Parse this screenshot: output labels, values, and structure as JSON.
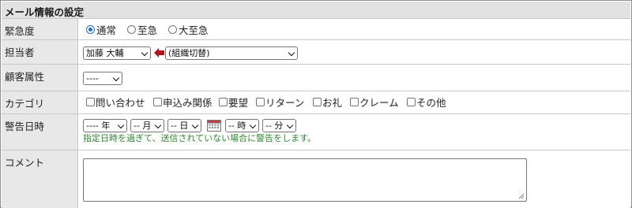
{
  "section_title": "メール情報の設定",
  "urgency": {
    "label": "緊急度",
    "options": [
      "通常",
      "至急",
      "大至急"
    ],
    "selected_index": 0
  },
  "assignee": {
    "label": "担当者",
    "selected": "加藤 大輔",
    "group_selected": "(組織切替)"
  },
  "customer_attribute": {
    "label": "顧客属性",
    "selected": "----"
  },
  "category": {
    "label": "カテゴリ",
    "options": [
      "問い合わせ",
      "申込み関係",
      "要望",
      "リターン",
      "お礼",
      "クレーム",
      "その他"
    ]
  },
  "alert_datetime": {
    "label": "警告日時",
    "year": "---- 年",
    "month": "-- 月",
    "day": "-- 日",
    "hour": "-- 時",
    "minute": "-- 分",
    "note": "指定日時を過ぎて、送信されていない場合に警告をします。"
  },
  "comment": {
    "label": "コメント",
    "value": ""
  },
  "colors": {
    "header_bg": "#e2e2e2",
    "label_bg": "#e8e8e8",
    "accent_radio": "#1a6fd6",
    "note_green": "#2f8a2f",
    "arrow_red": "#b1121b"
  }
}
